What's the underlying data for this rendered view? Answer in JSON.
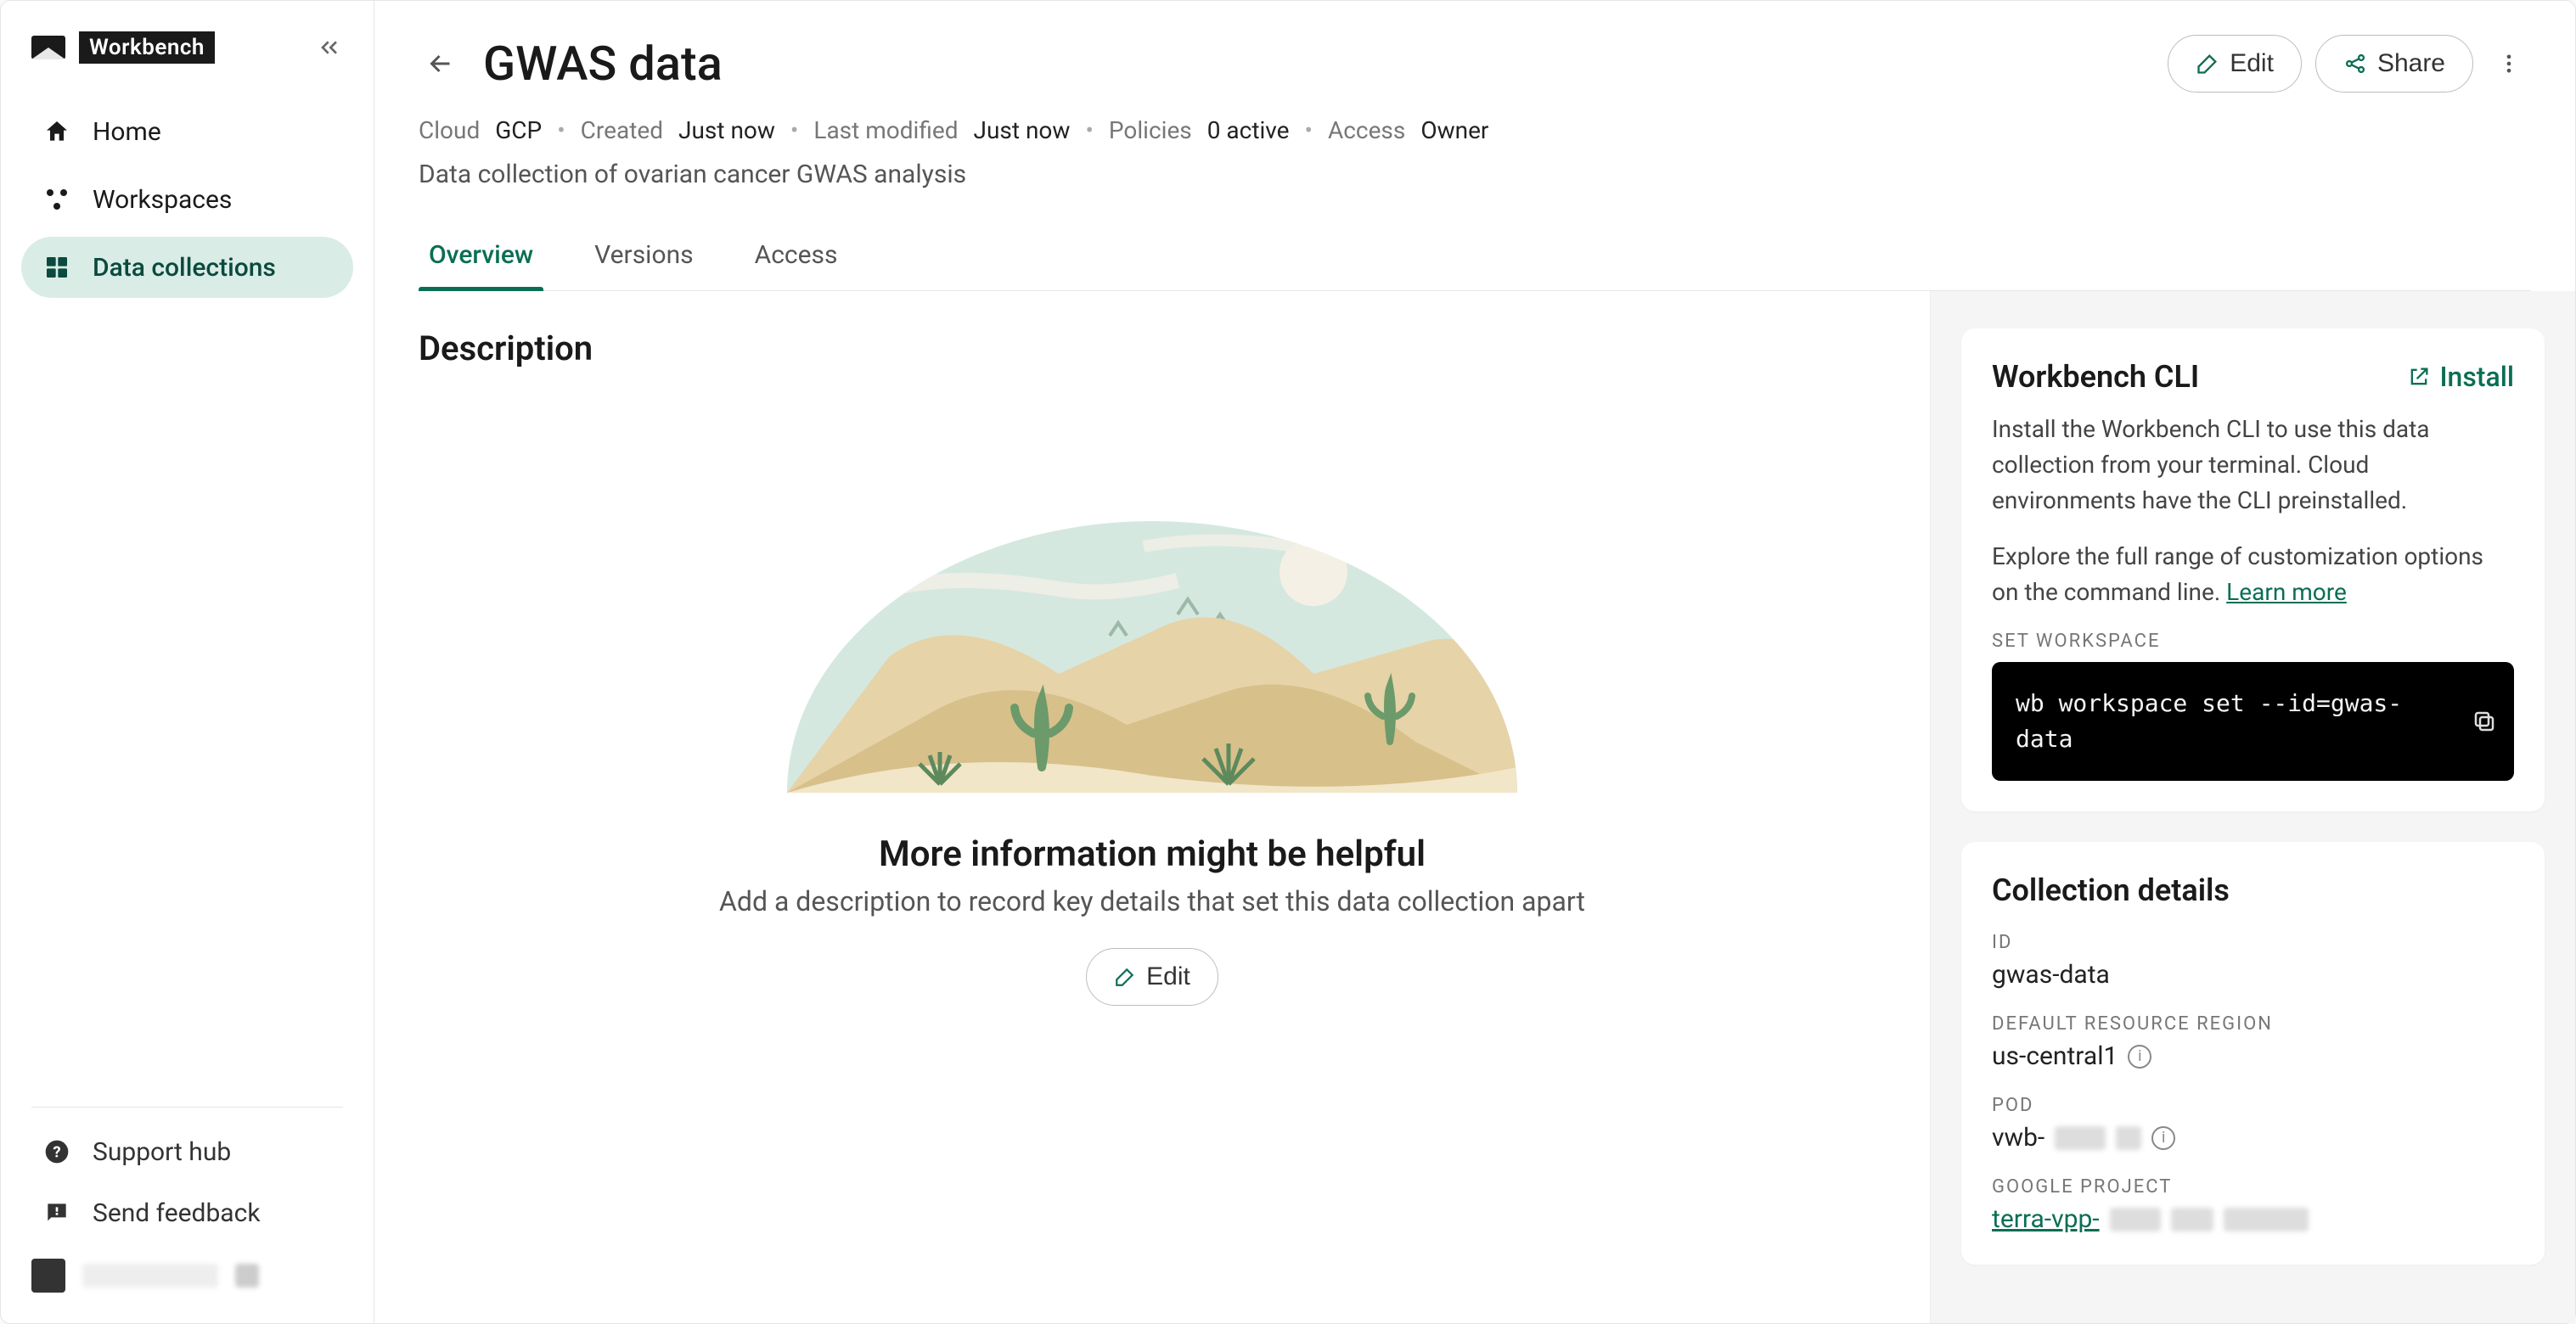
{
  "brand": "Workbench",
  "sidebar": {
    "items": [
      {
        "label": "Home"
      },
      {
        "label": "Workspaces"
      },
      {
        "label": "Data collections"
      }
    ],
    "support": "Support hub",
    "feedback": "Send feedback"
  },
  "header": {
    "title": "GWAS data",
    "edit": "Edit",
    "share": "Share",
    "meta": {
      "cloud_label": "Cloud",
      "cloud_val": "GCP",
      "created_label": "Created",
      "created_val": "Just now",
      "modified_label": "Last modified",
      "modified_val": "Just now",
      "policies_label": "Policies",
      "policies_val": "0 active",
      "access_label": "Access",
      "access_val": "Owner"
    },
    "subtitle": "Data collection of ovarian cancer GWAS analysis"
  },
  "tabs": [
    {
      "label": "Overview",
      "active": true
    },
    {
      "label": "Versions"
    },
    {
      "label": "Access"
    }
  ],
  "description": {
    "heading": "Description",
    "empty_title": "More information might be helpful",
    "empty_sub": "Add a description to record key details that set this data collection apart",
    "edit": "Edit"
  },
  "cli": {
    "heading": "Workbench CLI",
    "install": "Install",
    "p1": "Install the Workbench CLI to use this data collection from your terminal. Cloud environments have the CLI preinstalled.",
    "p2a": "Explore the full range of customization options on the command line. ",
    "learn": "Learn more",
    "cmd_label": "Set Workspace",
    "cmd": "wb workspace set --id=gwas-data"
  },
  "details": {
    "heading": "Collection details",
    "id_label": "ID",
    "id_val": "gwas-data",
    "region_label": "Default Resource Region",
    "region_val": "us-central1",
    "pod_label": "Pod",
    "pod_prefix": "vwb-",
    "gproj_label": "Google Project",
    "gproj_prefix": "terra-vpp-"
  }
}
